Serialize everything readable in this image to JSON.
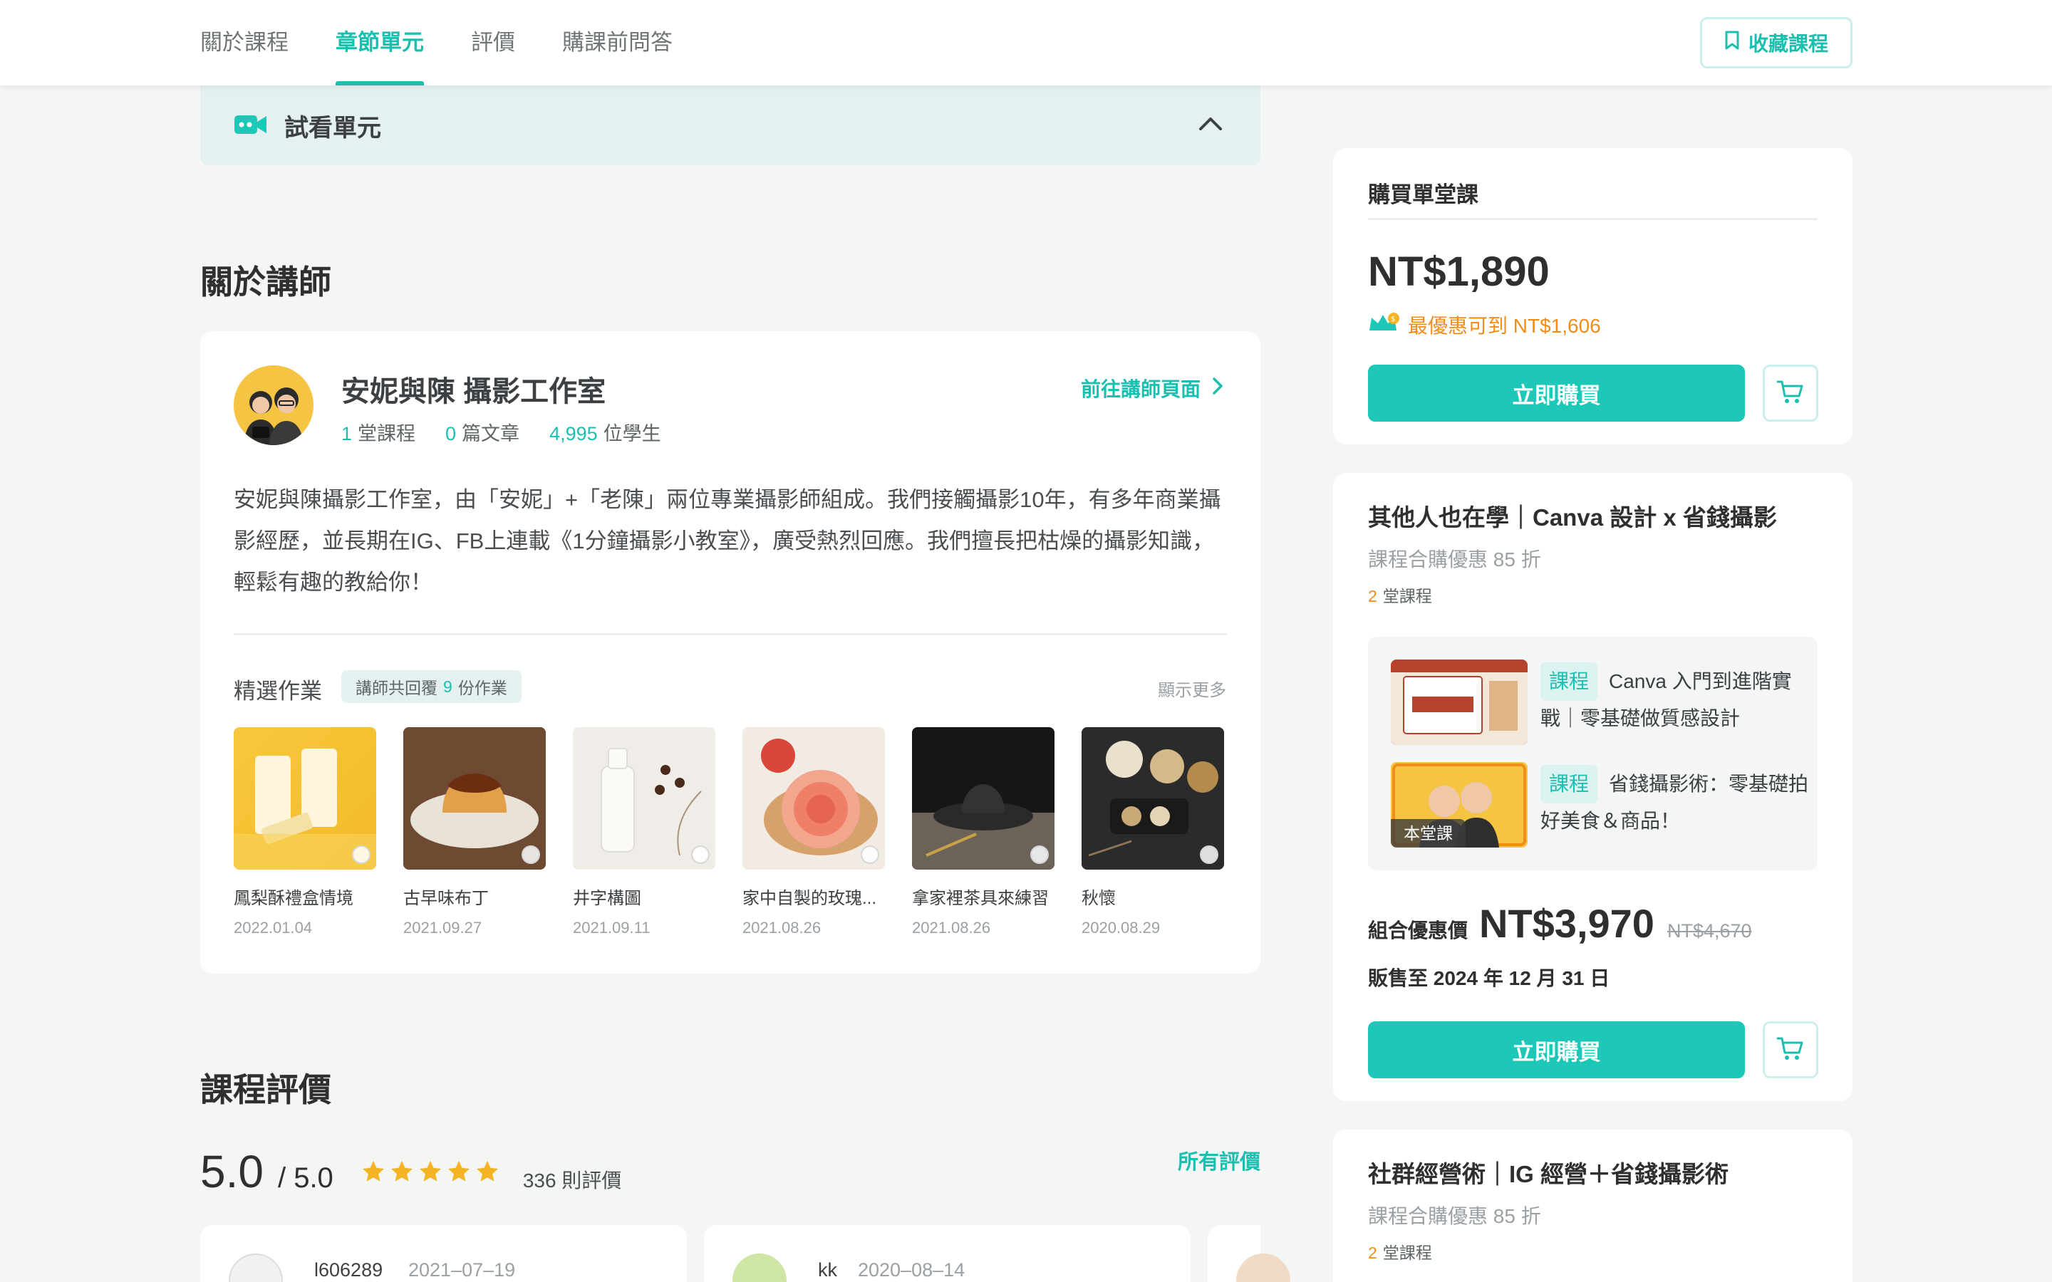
{
  "nav": {
    "tabs": [
      {
        "label": "關於課程"
      },
      {
        "label": "章節單元"
      },
      {
        "label": "評價"
      },
      {
        "label": "購課前問答"
      }
    ],
    "active_tab": 1,
    "favorite_label": "收藏課程"
  },
  "preview": {
    "label": "試看單元"
  },
  "instructor_section": {
    "title": "關於講師",
    "name": "安妮與陳  攝影工作室",
    "stats": {
      "courses_num": "1",
      "courses_label": "堂課程",
      "articles_num": "0",
      "articles_label": "篇文章",
      "students_num": "4,995",
      "students_label": "位學生"
    },
    "goto_label": "前往講師頁面",
    "bio": "安妮與陳攝影工作室，由「安妮」+「老陳」兩位專業攝影師組成。我們接觸攝影10年，有多年商業攝影經歷，並長期在IG、FB上連載《1分鐘攝影小教室》，廣受熱烈回應。我們擅長把枯燥的攝影知識，輕鬆有趣的教給你！",
    "works_title": "精選作業",
    "works_badge_pre": "講師共回覆",
    "works_badge_num": "9",
    "works_badge_post": "份作業",
    "show_more": "顯示更多",
    "works": [
      {
        "title": "鳳梨酥禮盒情境",
        "date": "2022.01.04"
      },
      {
        "title": "古早味布丁",
        "date": "2021.09.27"
      },
      {
        "title": "井字構圖",
        "date": "2021.09.11"
      },
      {
        "title": "家中自製的玫瑰...",
        "date": "2021.08.26"
      },
      {
        "title": "拿家裡茶具來練習",
        "date": "2021.08.26"
      },
      {
        "title": "秋懷",
        "date": "2020.08.29"
      }
    ]
  },
  "reviews_section": {
    "title": "課程評價",
    "score": "5.0",
    "max": "/ 5.0",
    "stars": 5,
    "count": "336 則評價",
    "all_label": "所有評價",
    "reviews": [
      {
        "user": "l606289",
        "date": "2021–07–19"
      },
      {
        "user": "kk",
        "date": "2020–08–14"
      }
    ]
  },
  "buy_card": {
    "title": "購買單堂課",
    "price": "NT$1,890",
    "best_label": "最優惠可到 NT$1,606",
    "buy_label": "立即購買"
  },
  "bundle1": {
    "title": "其他人也在學｜Canva 設計 x 省錢攝影",
    "subtitle": "課程合購優惠 85 折",
    "count_num": "2",
    "count_label": "堂課程",
    "items": [
      {
        "tag": "課程",
        "title": "Canva 入門到進階實戰｜零基礎做質感設計"
      },
      {
        "tag": "課程",
        "title": "省錢攝影術：零基礎拍好美食＆商品！",
        "badge": "本堂課"
      }
    ],
    "combo_label": "組合優惠價",
    "combo_price": "NT$3,970",
    "combo_original": "NT$4,670",
    "sale_until": "販售至 2024 年 12 月 31 日",
    "buy_label": "立即購買"
  },
  "bundle2": {
    "title": "社群經營術｜IG 經營＋省錢攝影術",
    "subtitle": "課程合購優惠 85 折",
    "count_num": "2",
    "count_label": "堂課程"
  },
  "colors": {
    "accent": "#1bbfb0",
    "button": "#1ec8b8",
    "orange": "#f08c1a",
    "star": "#f5b423"
  }
}
